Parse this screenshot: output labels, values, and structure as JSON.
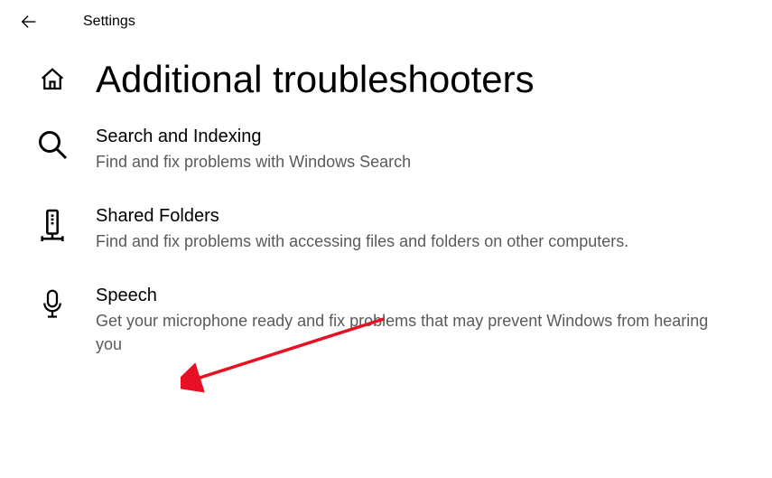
{
  "topbar": {
    "title": "Settings"
  },
  "page": {
    "title": "Additional troubleshooters"
  },
  "items": [
    {
      "title": "Search and Indexing",
      "desc": "Find and fix problems with Windows Search"
    },
    {
      "title": "Shared Folders",
      "desc": "Find and fix problems with accessing files and folders on other computers."
    },
    {
      "title": "Speech",
      "desc": "Get your microphone ready and fix problems that may prevent Windows from hearing you"
    }
  ]
}
